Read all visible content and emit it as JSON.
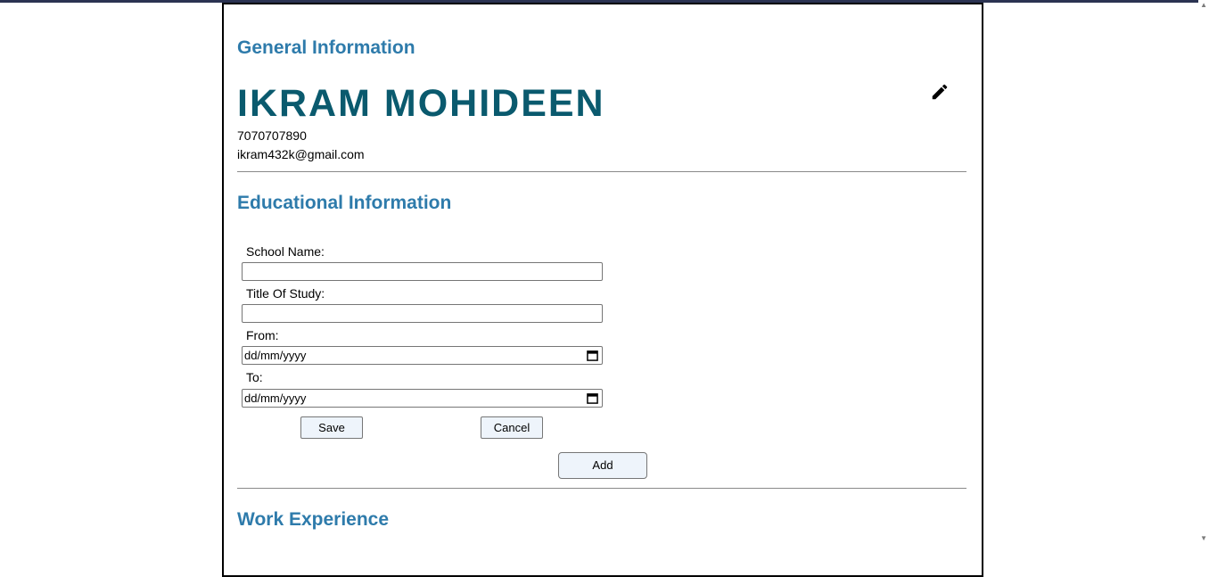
{
  "general": {
    "heading": "General Information",
    "name": "IKRAM MOHIDEEN",
    "phone": "7070707890",
    "email": "ikram432k@gmail.com",
    "edit_icon": "pencil-icon"
  },
  "education": {
    "heading": "Educational Information",
    "school_label": "School Name:",
    "school_value": "",
    "study_label": "Title Of Study:",
    "study_value": "",
    "from_label": "From:",
    "from_placeholder": "dd/mm/yyyy",
    "to_label": "To:",
    "to_placeholder": "dd/mm/yyyy",
    "save_label": "Save",
    "cancel_label": "Cancel",
    "add_label": "Add"
  },
  "work": {
    "heading": "Work Experience"
  },
  "colors": {
    "heading": "#2e7bab",
    "name": "#0a5a6e",
    "button_bg": "#eef4fb",
    "top_bar": "#2b3352"
  }
}
